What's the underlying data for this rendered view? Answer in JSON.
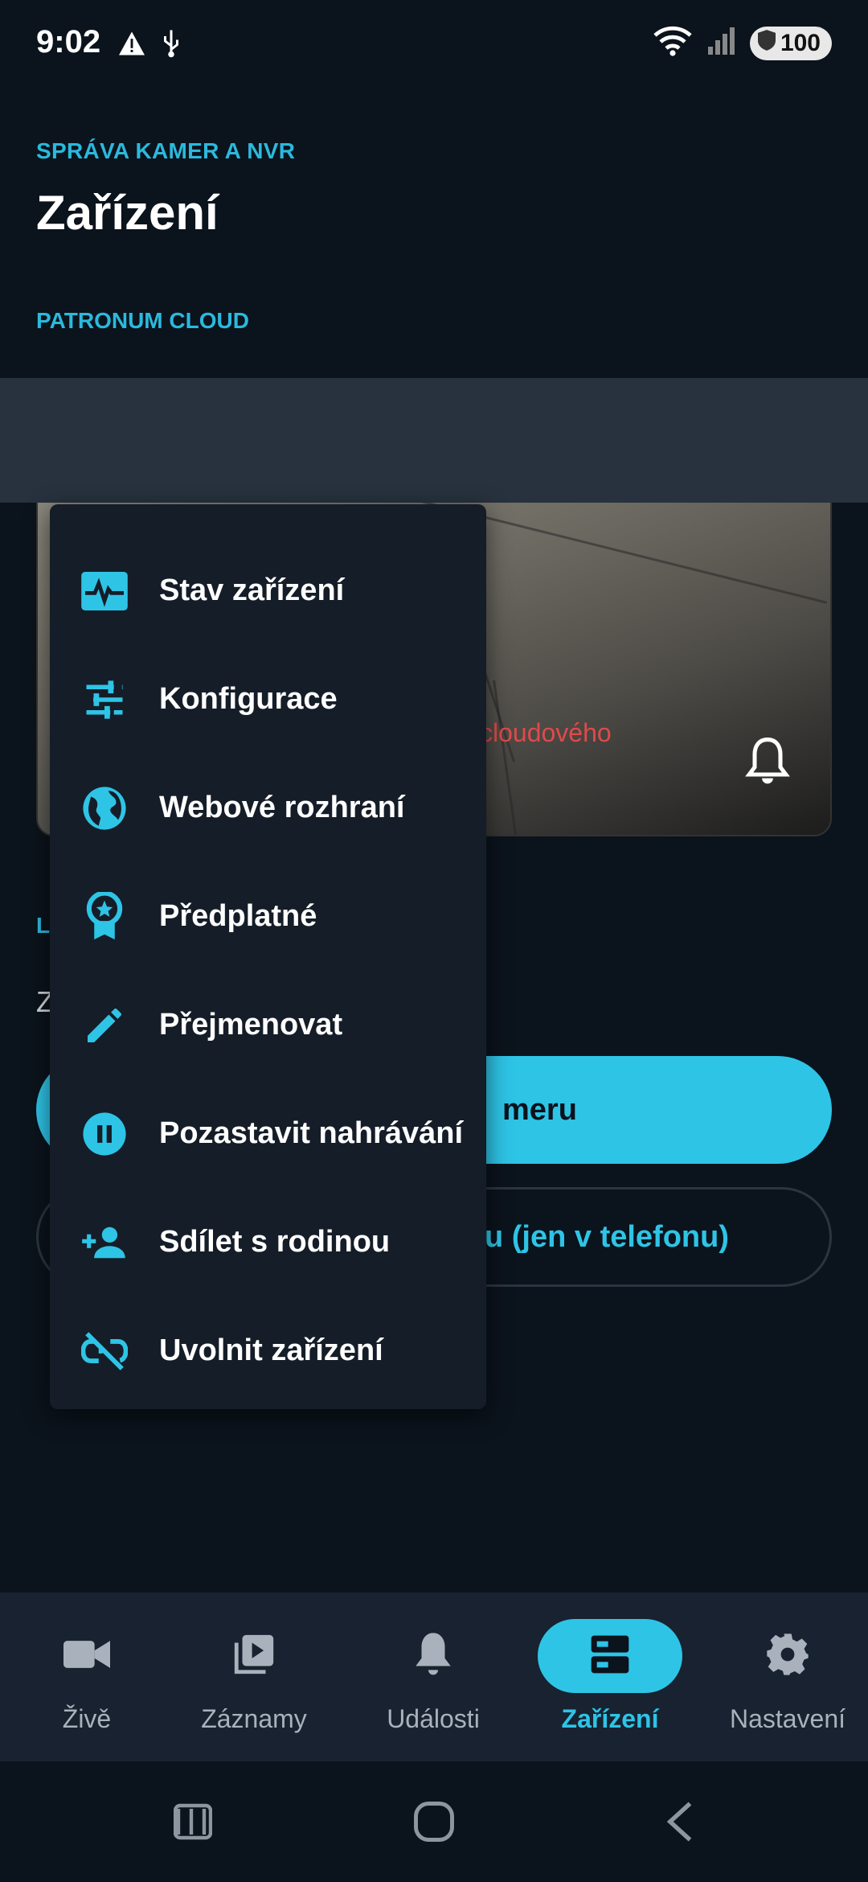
{
  "status_bar": {
    "time": "9:02",
    "battery": "100",
    "icons": [
      "warning-icon",
      "usb-icon",
      "wifi-icon",
      "signal-icon",
      "battery-shield-icon"
    ]
  },
  "header": {
    "subtitle": "SPRÁVA KAMER A NVR",
    "title": "Zařízení"
  },
  "sections": {
    "cloud": "PATRONUM CLOUD",
    "local_partial": "L",
    "local_text_partial": "Z"
  },
  "camera_card": {
    "error_partial": "cloudového",
    "bell_icon": "bell-icon"
  },
  "buttons": {
    "primary_partial": "meru",
    "secondary_partial": "u (jen v telefonu)"
  },
  "menu": {
    "items": [
      {
        "label": "Stav zařízení",
        "icon": "device-status-icon"
      },
      {
        "label": "Konfigurace",
        "icon": "sliders-icon"
      },
      {
        "label": "Webové rozhraní",
        "icon": "globe-icon"
      },
      {
        "label": "Předplatné",
        "icon": "award-icon"
      },
      {
        "label": "Přejmenovat",
        "icon": "pencil-icon"
      },
      {
        "label": "Pozastavit nahrávání",
        "icon": "pause-circle-icon"
      },
      {
        "label": "Sdílet s rodinou",
        "icon": "add-person-icon"
      },
      {
        "label": "Uvolnit zařízení",
        "icon": "link-off-icon"
      }
    ]
  },
  "bottom_nav": {
    "items": [
      {
        "label": "Živě",
        "icon": "videocam-icon",
        "active": false
      },
      {
        "label": "Záznamy",
        "icon": "video-library-icon",
        "active": false
      },
      {
        "label": "Události",
        "icon": "bell-icon",
        "active": false
      },
      {
        "label": "Zařízení",
        "icon": "dns-icon",
        "active": true
      },
      {
        "label": "Nastavení",
        "icon": "gear-icon",
        "active": false
      }
    ]
  },
  "colors": {
    "accent": "#2ec4e6",
    "background": "#0b131c",
    "menu_bg": "#151d28",
    "error": "#e04a4a"
  }
}
